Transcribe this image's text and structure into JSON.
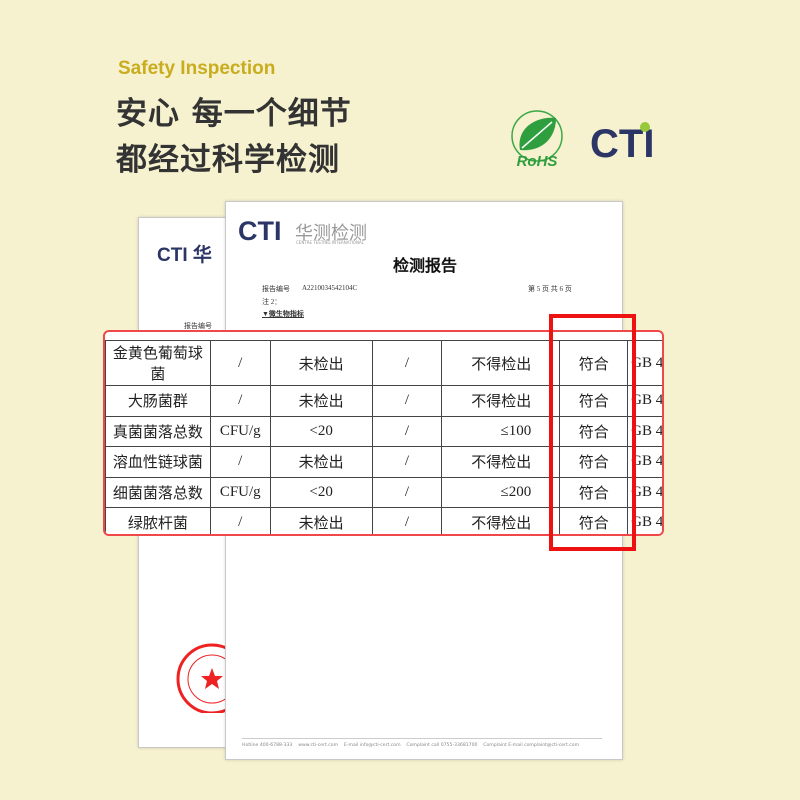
{
  "header": {
    "subtitle_en": "Safety Inspection",
    "line1": "安心 每一个细节",
    "line2": "都经过科学检测"
  },
  "logos": {
    "rohs": "RoHS",
    "cti": "CTI"
  },
  "report": {
    "logo_cn": "华测检测",
    "logo_en": "CENTRE TESTING INTERNATIONAL",
    "title": "检测报告",
    "report_no_label": "报告编号",
    "report_no": "A2210034542104C",
    "page": "第 5 页  共 6 页",
    "note": "注 2：",
    "section": "▼微生物指标",
    "back_logo": "CTI 华",
    "back_no_label": "报告编号",
    "footer": "Hotline 400-6788-333    www.cti-cert.com    E-mail info@cti-cert.com    Complaint call 0755-33681700    Complaint E-mail complaint@cti-cert.com"
  },
  "table": {
    "rows": [
      [
        "金黄色葡萄球菌",
        "/",
        "未检出",
        "/",
        "不得检出",
        "符合",
        "GB 4"
      ],
      [
        "大肠菌群",
        "/",
        "未检出",
        "/",
        "不得检出",
        "符合",
        "GB 4"
      ],
      [
        "真菌菌落总数",
        "CFU/g",
        "<20",
        "/",
        "≤100",
        "符合",
        "GB 4"
      ],
      [
        "溶血性链球菌",
        "/",
        "未检出",
        "/",
        "不得检出",
        "符合",
        "GB 4"
      ],
      [
        "细菌菌落总数",
        "CFU/g",
        "<20",
        "/",
        "≤200",
        "符合",
        "GB 4"
      ],
      [
        "绿脓杆菌",
        "/",
        "未检出",
        "/",
        "不得检出",
        "符合",
        "GB 4"
      ]
    ]
  },
  "colors": {
    "background": "#f6f1cf",
    "accent": "#c9ad1e",
    "highlight": "#ee1111",
    "brand": "#2b3566"
  }
}
